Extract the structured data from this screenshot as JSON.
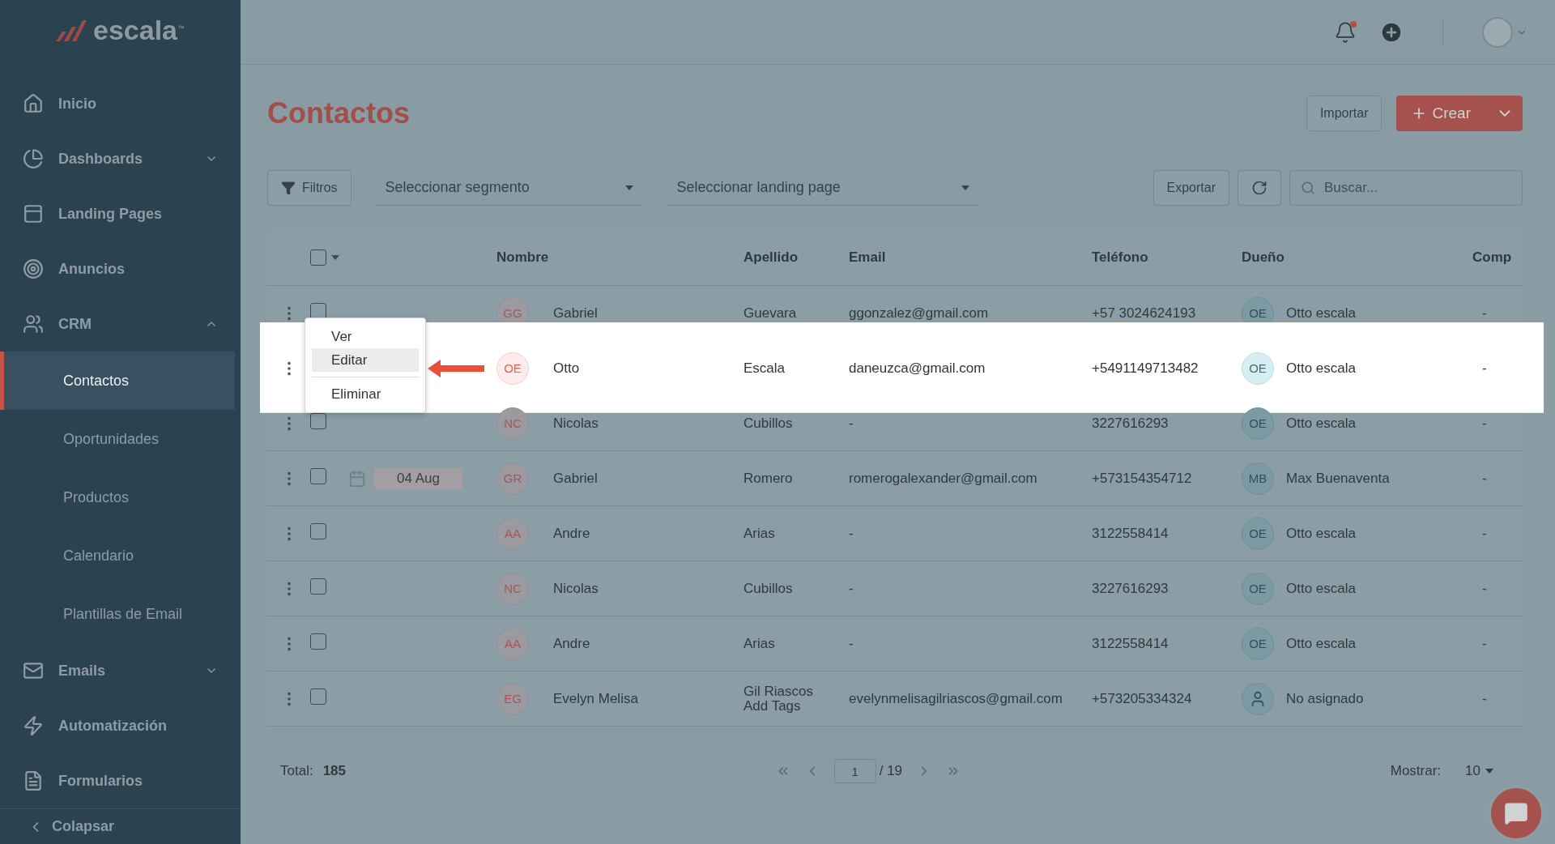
{
  "brand": {
    "name": "escala",
    "mark": "™"
  },
  "sidebar": {
    "items": [
      {
        "label": "Inicio",
        "kind": "link"
      },
      {
        "label": "Dashboards",
        "kind": "group",
        "expanded": false
      },
      {
        "label": "Landing Pages",
        "kind": "link"
      },
      {
        "label": "Anuncios",
        "kind": "link"
      },
      {
        "label": "CRM",
        "kind": "group",
        "expanded": true,
        "children": [
          {
            "label": "Contactos",
            "selected": true
          },
          {
            "label": "Oportunidades",
            "selected": false
          },
          {
            "label": "Productos",
            "selected": false
          },
          {
            "label": "Calendario",
            "selected": false
          },
          {
            "label": "Plantillas de Email",
            "selected": false
          }
        ]
      },
      {
        "label": "Emails",
        "kind": "group",
        "expanded": false
      },
      {
        "label": "Automatización",
        "kind": "link"
      },
      {
        "label": "Formularios",
        "kind": "link"
      }
    ],
    "collapse": "Colapsar"
  },
  "page": {
    "title": "Contactos",
    "import": "Importar",
    "create": "Crear"
  },
  "filters": {
    "filter": "Filtros",
    "segment": "Seleccionar segmento",
    "landing": "Seleccionar landing page",
    "export": "Exportar",
    "search_placeholder": "Buscar..."
  },
  "table": {
    "select_all_checked": false,
    "columns": [
      "Nombre",
      "Apellido",
      "Email",
      "Teléfono",
      "Dueño",
      "Comp"
    ],
    "rows": [
      {
        "highlighted": false,
        "checked": false,
        "initials": "GG",
        "name": "Gabriel",
        "last": "Guevara",
        "email": "ggonzalez@gmail.com",
        "phone": "+57 3024624193",
        "owner_initials": "OE",
        "owner": "Otto escala",
        "comp": "-"
      },
      {
        "highlighted": true,
        "initials": "OE",
        "name": "Otto",
        "last": "Escala",
        "email": "daneuzca@gmail.com",
        "phone": "+5491149713482",
        "owner_initials": "OE",
        "owner": "Otto escala",
        "comp": "-"
      },
      {
        "highlighted": false,
        "checked": false,
        "initials": "NC",
        "name": "Nicolas",
        "last": "Cubillos",
        "email": "-",
        "phone": "3227616293",
        "owner_initials": "OE",
        "owner": "Otto escala",
        "comp": "-"
      },
      {
        "highlighted": false,
        "checked": false,
        "date": "04 Aug",
        "initials": "GR",
        "name": "Gabriel",
        "last": "Romero",
        "email": "romerogalexander@gmail.com",
        "phone": "+573154354712",
        "owner_initials": "MB",
        "owner": "Max Buenaventa",
        "comp": "-"
      },
      {
        "highlighted": false,
        "checked": false,
        "initials": "AA",
        "name": "Andre",
        "last": "Arias",
        "email": "-",
        "phone": "3122558414",
        "owner_initials": "OE",
        "owner": "Otto escala",
        "comp": "-"
      },
      {
        "highlighted": false,
        "checked": false,
        "initials": "NC",
        "name": "Nicolas",
        "last": "Cubillos",
        "email": "-",
        "phone": "3227616293",
        "owner_initials": "OE",
        "owner": "Otto escala",
        "comp": "-"
      },
      {
        "highlighted": false,
        "checked": false,
        "initials": "AA",
        "name": "Andre",
        "last": "Arias",
        "email": "-",
        "phone": "3122558414",
        "owner_initials": "OE",
        "owner": "Otto escala",
        "comp": "-"
      },
      {
        "highlighted": false,
        "checked": false,
        "initials": "EG",
        "name": "Evelyn Melisa",
        "last": "Gil Riascos",
        "tags": "Add Tags",
        "email": "evelynmelisagilriascos@gmail.com",
        "phone": "+573205334324",
        "owner": "No asignado",
        "comp": "-"
      }
    ]
  },
  "row_menu": {
    "items": [
      {
        "label": "Ver",
        "selected": false
      },
      {
        "label": "Editar",
        "selected": true
      },
      {
        "label": "Eliminar",
        "selected": false
      }
    ]
  },
  "footer": {
    "total_label": "Total:",
    "total": "185",
    "page": "1",
    "pages": "/ 19",
    "show_label": "Mostrar:",
    "show": "10"
  }
}
